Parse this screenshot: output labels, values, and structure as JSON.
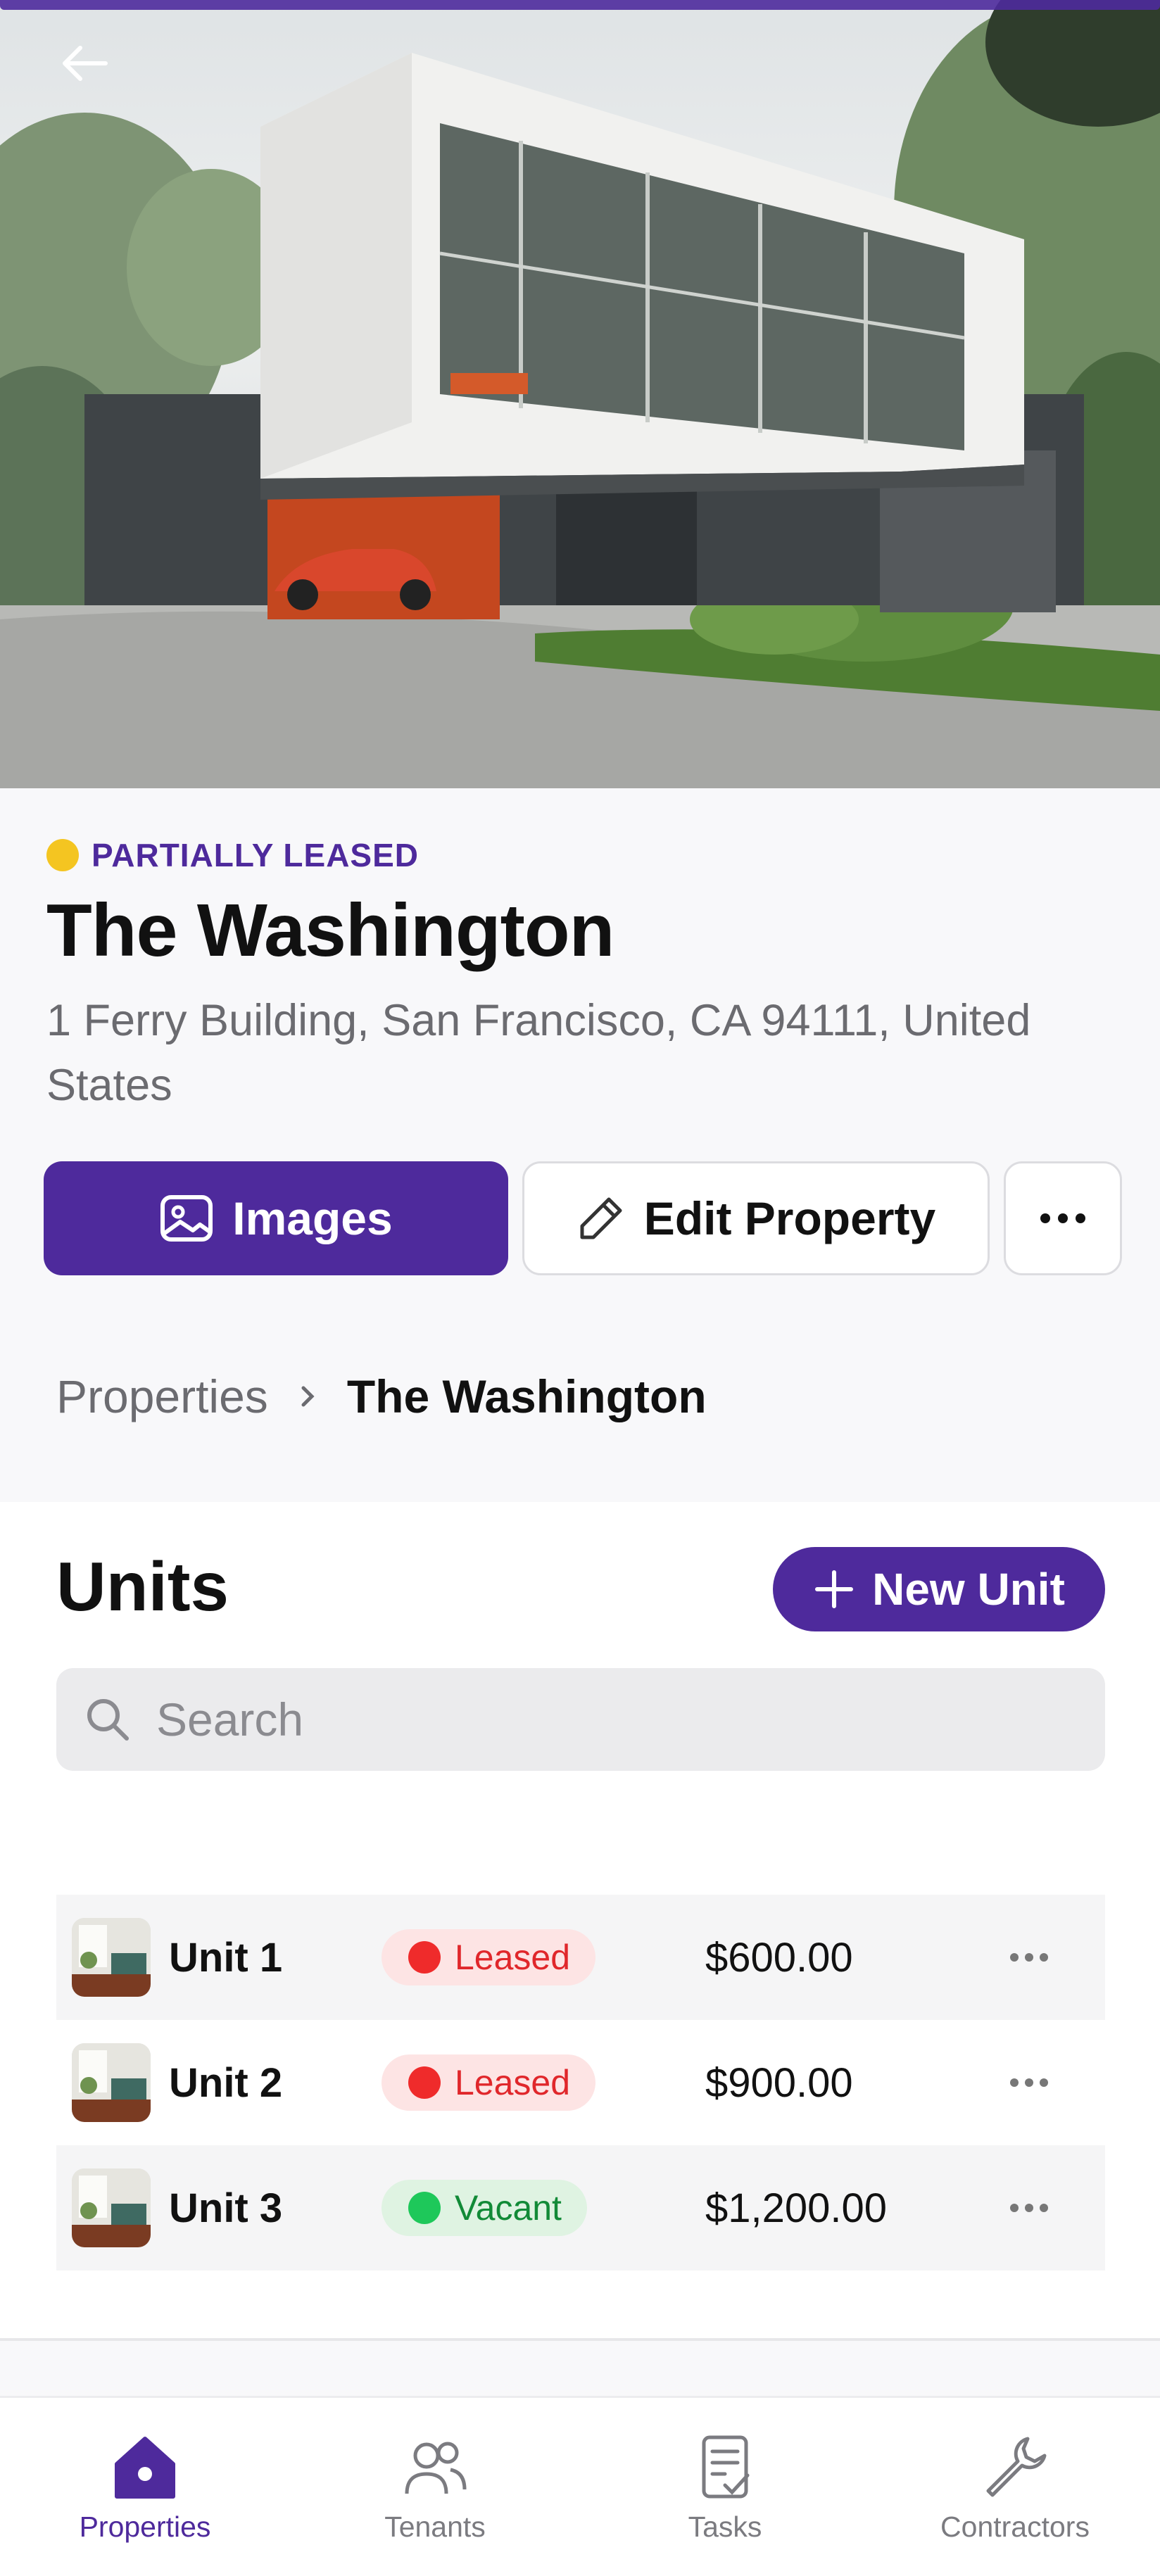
{
  "hero": {
    "back_label": "Back"
  },
  "property": {
    "status": "PARTIALLY LEASED",
    "name": "The Washington",
    "address": "1 Ferry Building, San Francisco, CA 94111, United States"
  },
  "actions": {
    "images_label": "Images",
    "edit_label": "Edit Property",
    "more_icon": "more-horizontal-icon"
  },
  "breadcrumb": {
    "parent": "Properties",
    "current": "The Washington"
  },
  "units": {
    "title": "Units",
    "new_unit_label": "New Unit",
    "search_placeholder": "Search",
    "rows": [
      {
        "name": "Unit 1",
        "status": "Leased",
        "price": "$600.00"
      },
      {
        "name": "Unit 2",
        "status": "Leased",
        "price": "$900.00"
      },
      {
        "name": "Unit 3",
        "status": "Vacant",
        "price": "$1,200.00"
      }
    ]
  },
  "colors": {
    "brand": "#4e2a9c",
    "status_partial": "#f4c521",
    "leased_bg": "#fde4e4",
    "leased_dot": "#ef2b2b",
    "leased_text": "#e0272b",
    "vacant_bg": "#dff3e2",
    "vacant_dot": "#1ec85a",
    "vacant_text": "#128a37"
  },
  "tabbar": {
    "items": [
      {
        "label": "Properties",
        "icon": "home-icon",
        "active": true
      },
      {
        "label": "Tenants",
        "icon": "users-icon",
        "active": false
      },
      {
        "label": "Tasks",
        "icon": "clipboard-check-icon",
        "active": false
      },
      {
        "label": "Contractors",
        "icon": "wrench-icon",
        "active": false
      }
    ]
  }
}
